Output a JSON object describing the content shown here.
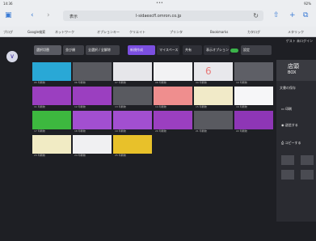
{
  "status": {
    "time": "14:36",
    "right": "92%"
  },
  "browser": {
    "tab_label": "表示",
    "url": "l-sidaexcfl.omron.co.jp",
    "aa": "AA"
  },
  "bookmarks": [
    "ブログ",
    "Google検索",
    "ネットワーク",
    "オプションキー",
    "クリエイト",
    "プリンタ",
    "Bookmarks",
    "カタログ",
    "メタリック"
  ],
  "app": {
    "user": "ゲスト 未ログイン",
    "toolbar": {
      "item1": "選択切替",
      "item2": "並び順",
      "item3": "全選択 / 全解除",
      "item4": "新規作成",
      "item5": "マイスペース",
      "item6": "共有",
      "item7": "表示オプション",
      "item8": "設定"
    },
    "right_panel": {
      "big_label": "店頭",
      "big_sub": "BOX",
      "sub_label": "文書の保存",
      "btn1": "印刷",
      "btn2": "送信する",
      "btn3": "コピーする"
    },
    "tiles": [
      {
        "color": "#29a8d6",
        "footer": "05 印刷物"
      },
      {
        "color": "#595a60",
        "footer": "06 印刷物"
      },
      {
        "color": "#e6e6ea",
        "footer": "07 印刷物"
      },
      {
        "color": "#f2f2f4",
        "footer": "08 印刷物"
      },
      {
        "color": "#e8e8ec",
        "footer": "09 印刷物",
        "text": "6"
      },
      {
        "color": "#5e5f66",
        "footer": "10 印刷物"
      },
      {
        "color": "#9b3fc0",
        "footer": "11 印刷物"
      },
      {
        "color": "#9b3fc0",
        "footer": "12 印刷物"
      },
      {
        "color": "#595a60",
        "footer": "13 印刷物"
      },
      {
        "color": "#ef8e8e",
        "footer": "14 印刷物"
      },
      {
        "color": "#f1eac8",
        "footer": "15 印刷物"
      },
      {
        "color": "#f6f6f8",
        "footer": "16 印刷物"
      },
      {
        "color": "#3db83f",
        "footer": "17 印刷物"
      },
      {
        "color": "#a24fd0",
        "footer": "18 印刷物"
      },
      {
        "color": "#a24fd0",
        "footer": "19 印刷物"
      },
      {
        "color": "#9b3fc0",
        "footer": "20 印刷物"
      },
      {
        "color": "#595a60",
        "footer": "21 印刷物"
      },
      {
        "color": "#8e36b6",
        "footer": "22 印刷物"
      },
      {
        "color": "#f1ebc4",
        "footer": "23 印刷物"
      },
      {
        "color": "#f0f0f2",
        "footer": "24 印刷物"
      },
      {
        "color": "#e8c12a",
        "footer": "25 印刷物"
      }
    ]
  }
}
